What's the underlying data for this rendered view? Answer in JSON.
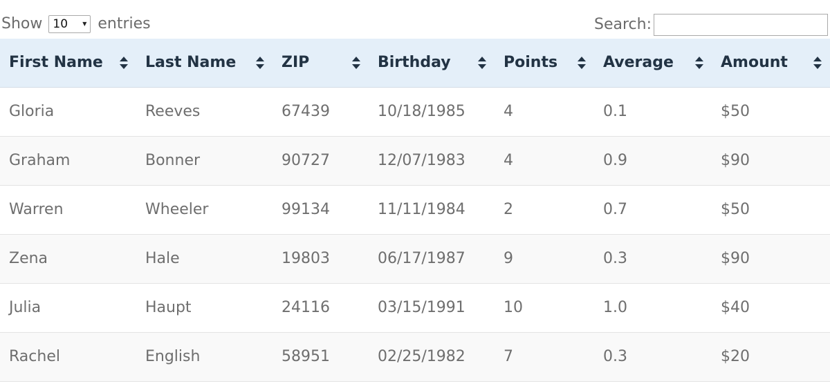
{
  "length": {
    "show_label": "Show",
    "selected": "10",
    "entries_label": "entries"
  },
  "search": {
    "label": "Search:",
    "value": ""
  },
  "table": {
    "columns": [
      "First Name",
      "Last Name",
      "ZIP",
      "Birthday",
      "Points",
      "Average",
      "Amount"
    ],
    "rows": [
      [
        "Gloria",
        "Reeves",
        "67439",
        "10/18/1985",
        "4",
        "0.1",
        "$50"
      ],
      [
        "Graham",
        "Bonner",
        "90727",
        "12/07/1983",
        "4",
        "0.9",
        "$90"
      ],
      [
        "Warren",
        "Wheeler",
        "99134",
        "11/11/1984",
        "2",
        "0.7",
        "$50"
      ],
      [
        "Zena",
        "Hale",
        "19803",
        "06/17/1987",
        "9",
        "0.3",
        "$90"
      ],
      [
        "Julia",
        "Haupt",
        "24116",
        "03/15/1991",
        "10",
        "1.0",
        "$40"
      ],
      [
        "Rachel",
        "English",
        "58951",
        "02/25/1982",
        "7",
        "0.3",
        "$20"
      ]
    ]
  },
  "colors": {
    "header_bg": "#e4eff9",
    "header_text": "#223344",
    "cell_text": "#6e6e6e",
    "stripe": "#f9f9f9"
  },
  "icons": {
    "sort": "sort-both-icon",
    "dropdown": "dropdown-arrow-icon"
  }
}
